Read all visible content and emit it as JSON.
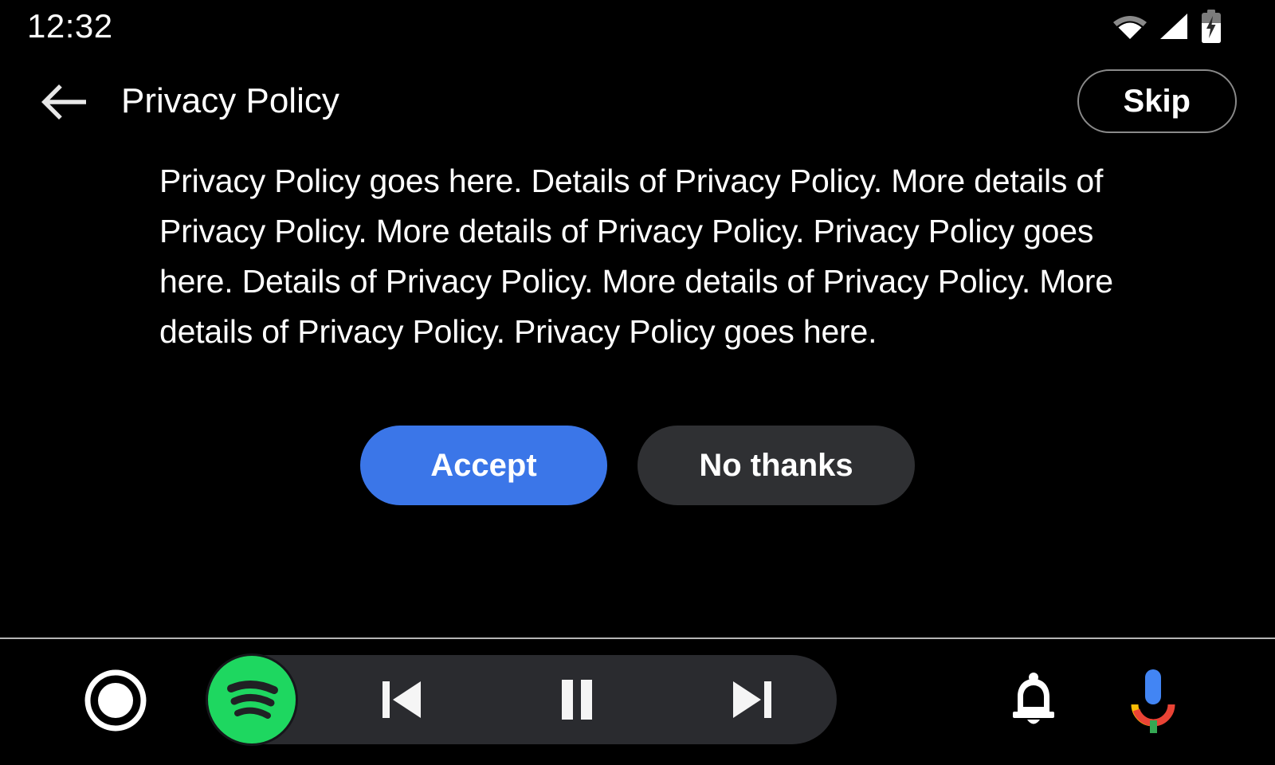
{
  "status_bar": {
    "clock": "12:32",
    "icons": [
      {
        "name": "wifi-icon",
        "label": "Wi-Fi"
      },
      {
        "name": "cellular-signal-icon",
        "label": "Cellular signal"
      },
      {
        "name": "battery-charging-icon",
        "label": "Battery charging"
      }
    ]
  },
  "header": {
    "back_icon": "back-arrow-icon",
    "title": "Privacy Policy",
    "skip_label": "Skip"
  },
  "content": {
    "policy_text": "Privacy Policy goes here. Details of Privacy Policy. More details of Privacy Policy. More details of Privacy Policy. Privacy Policy goes here. Details of Privacy Policy. More details of Privacy Policy. More details of Privacy Policy. Privacy Policy goes here.",
    "accept_label": "Accept",
    "decline_label": "No thanks"
  },
  "nav_bar": {
    "home_icon": "home-circle-icon",
    "media_app": "spotify-icon",
    "previous_icon": "skip-previous-icon",
    "play_pause_icon": "pause-icon",
    "next_icon": "skip-next-icon",
    "notifications_icon": "bell-icon",
    "assistant_icon": "google-assistant-mic-icon"
  },
  "colors": {
    "background": "#000000",
    "accept_blue": "#3b76e8",
    "decline_gray": "#2f3033",
    "media_pill": "#2a2b2f",
    "spotify_green": "#1ED760",
    "divider": "#b5b5b5",
    "skip_outline": "#8a8a8a",
    "assistant_blue": "#4285F4",
    "assistant_red": "#EA4335",
    "assistant_yellow": "#FBBC05",
    "assistant_green": "#34A853"
  }
}
